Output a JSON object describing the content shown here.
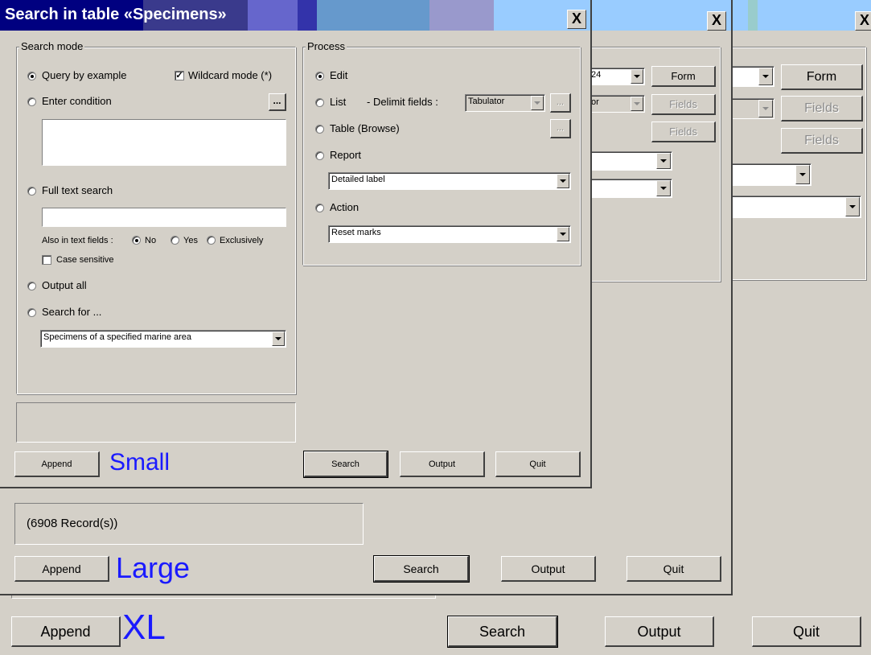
{
  "title": "Search in table «Specimens»",
  "close_glyph": "X",
  "size_labels": {
    "small": "Small",
    "large": "Large",
    "xl": "XL"
  },
  "buttons": {
    "form": "Form",
    "fields": "Fields",
    "append": "Append",
    "search": "Search",
    "output": "Output",
    "quit": "Quit",
    "ellipsis": "..."
  },
  "record_count": "(6908 Record(s))",
  "search_mode": {
    "legend": "Search mode",
    "query_by_example": "Query by example",
    "wildcard_mode": "Wildcard mode (*)",
    "enter_condition": "Enter condition",
    "full_text_search": "Full text search",
    "also_in_text_fields": "Also in text fields :",
    "no": "No",
    "yes": "Yes",
    "exclusively": "Exclusively",
    "case_sensitive": "Case sensitive",
    "output_all": "Output all",
    "search_for": "Search for ...",
    "search_for_value": "Specimens of a specified marine area"
  },
  "process": {
    "legend": "Process",
    "edit": "Edit",
    "list": "List",
    "delimit_fields": "- Delimit fields :",
    "delimit_value": "Tabulator",
    "table_browse": "Table (Browse)",
    "report": "Report",
    "report_value": "Detailed label",
    "action": "Action",
    "action_value": "Reset marks"
  },
  "behind": {
    "combo_small_1": "24",
    "combo_small_2": "or"
  },
  "colors": {
    "title_dark": "#000080",
    "label_blue": "#1a1aff"
  }
}
